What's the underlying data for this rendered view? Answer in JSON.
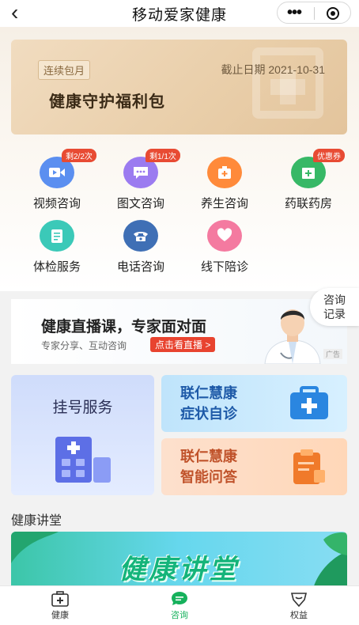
{
  "header": {
    "title": "移动爱家健康",
    "back_icon": "chevron-left-icon",
    "more_icon": "more-dots-icon",
    "close_icon": "record-circle-icon"
  },
  "welfare": {
    "tag": "连续包月",
    "deadline": "截止日期 2021-10-31",
    "title": "健康守护福利包"
  },
  "services": [
    {
      "label": "视频咨询",
      "badge": "剩2/2次",
      "icon": "video-icon",
      "color": "#5b8ff0"
    },
    {
      "label": "图文咨询",
      "badge": "剩1/1次",
      "icon": "chat-icon",
      "color": "#9b7bf0"
    },
    {
      "label": "养生咨询",
      "badge": "",
      "icon": "medical-kit-icon",
      "color": "#ff8a3a"
    },
    {
      "label": "药联药房",
      "badge": "优惠券",
      "icon": "pharmacy-icon",
      "color": "#37b866"
    },
    {
      "label": "体检服务",
      "badge": "",
      "icon": "checkup-icon",
      "color": "#3bc9b8"
    },
    {
      "label": "电话咨询",
      "badge": "",
      "icon": "phone-icon",
      "color": "#3f6fb5"
    },
    {
      "label": "线下陪诊",
      "badge": "",
      "icon": "heart-hand-icon",
      "color": "#f47aa0"
    }
  ],
  "ad": {
    "headline": "健康直播课，专家面对面",
    "sub": "专家分享、互动咨询",
    "cta": "点击看直播 >",
    "ad_tag": "广告"
  },
  "consult_records": {
    "line1": "咨询",
    "line2": "记录"
  },
  "cards": {
    "register": "挂号服务",
    "symptom_line1": "联仁慧康",
    "symptom_line2": "症状自诊",
    "qa_line1": "联仁慧康",
    "qa_line2": "智能问答"
  },
  "lecture": {
    "section_title": "健康讲堂",
    "banner_text": "健康讲堂"
  },
  "tabbar": [
    {
      "label": "健康",
      "icon": "medical-box-icon",
      "active": false
    },
    {
      "label": "咨询",
      "icon": "chat-bubble-icon",
      "active": true
    },
    {
      "label": "权益",
      "icon": "heart-badge-icon",
      "active": false
    }
  ],
  "colors": {
    "accent": "#16b15c",
    "badge": "#e84b33"
  }
}
